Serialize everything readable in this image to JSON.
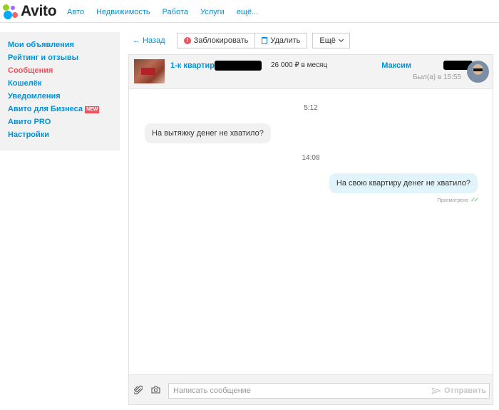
{
  "header": {
    "logo_text": "Avito",
    "nav": [
      "Авто",
      "Недвижимость",
      "Работа",
      "Услуги",
      "ещё..."
    ]
  },
  "sidebar": {
    "items": [
      {
        "label": "Мои объявления"
      },
      {
        "label": "Рейтинг и отзывы"
      },
      {
        "label": "Сообщения",
        "active": true
      },
      {
        "label": "Кошелёк"
      },
      {
        "label": "Уведомления"
      },
      {
        "label": "Авито для Бизнеса",
        "badge": "NEW"
      },
      {
        "label": "Авито PRO"
      },
      {
        "label": "Настройки"
      }
    ]
  },
  "toolbar": {
    "back": "← Назад",
    "block": "Заблокировать",
    "delete": "Удалить",
    "more": "Ещё"
  },
  "listing": {
    "title": "1-к квартира,",
    "price": "26 000 ₽ в месяц",
    "seller": "Максим",
    "seller_status": "Был(а) в 15:55"
  },
  "messages": [
    {
      "time": "5:12",
      "text": "На вытяжку денег не хватило?",
      "direction": "in"
    },
    {
      "time": "14:08",
      "text": "На свою квартиру денег не хватило?",
      "direction": "out",
      "status": "Просмотрено"
    }
  ],
  "composer": {
    "placeholder": "Написать сообщение",
    "send": "Отправить"
  },
  "colors": {
    "link": "#0091d9",
    "active": "#f2525d",
    "outgoing_bubble": "#e1f4fb",
    "incoming_bubble": "#f1f1f1",
    "read_ticks": "#5bc35b"
  }
}
